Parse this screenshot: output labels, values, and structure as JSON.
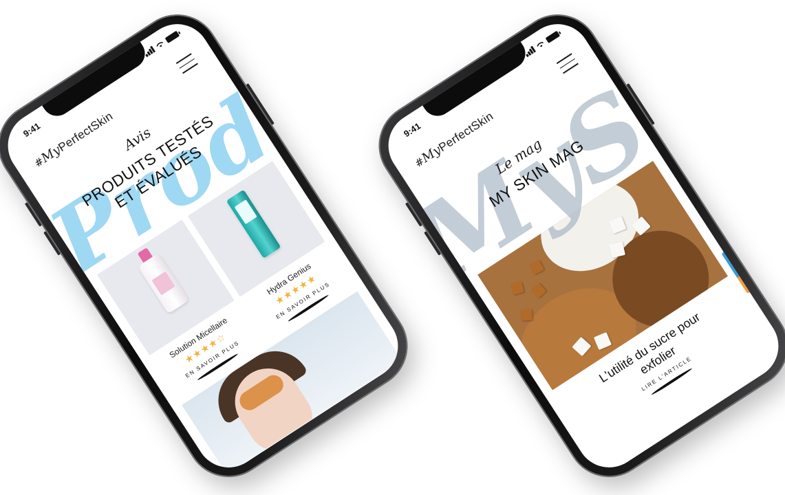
{
  "left_phone": {
    "status_time": "9:41",
    "brand": {
      "hash": "#",
      "script": "My",
      "rest": "PerfectSkin"
    },
    "hero": {
      "script_bg": "Prod",
      "eyebrow": "Avis",
      "title_line1": "PRODUITS TESTÉS",
      "title_line2": "ET ÉVALUÉS"
    },
    "products": [
      {
        "name": "Solution Micellaire",
        "rating": 4,
        "stars_filled": "★★★★",
        "stars_empty": "☆",
        "link": "EN SAVOIR PLUS"
      },
      {
        "name": "Hydra Genius",
        "rating": 5,
        "stars_filled": "★★★★★",
        "stars_empty": "",
        "link": "EN SAVOIR PLUS"
      }
    ]
  },
  "right_phone": {
    "status_time": "9:41",
    "brand": {
      "hash": "#",
      "script": "My",
      "rest": "PerfectSkin"
    },
    "hero": {
      "script_bg": "MySk",
      "eyebrow": "Le mag",
      "title": "MY SKIN MAG"
    },
    "article": {
      "title_line1": "L'utilité du sucre pour",
      "title_line2": "exfolier",
      "link": "LIRE L'ARTICLE"
    }
  },
  "icons": {
    "menu": "hamburger-icon",
    "signal": "signal-icon",
    "wifi": "wifi-icon",
    "battery": "battery-icon"
  },
  "colors": {
    "script_blue": "#8fd2f0",
    "script_grey": "#aab8c6",
    "star": "#f2b33d",
    "hydra_teal": "#1ea8a6",
    "micellar_pink": "#e36aa6"
  }
}
